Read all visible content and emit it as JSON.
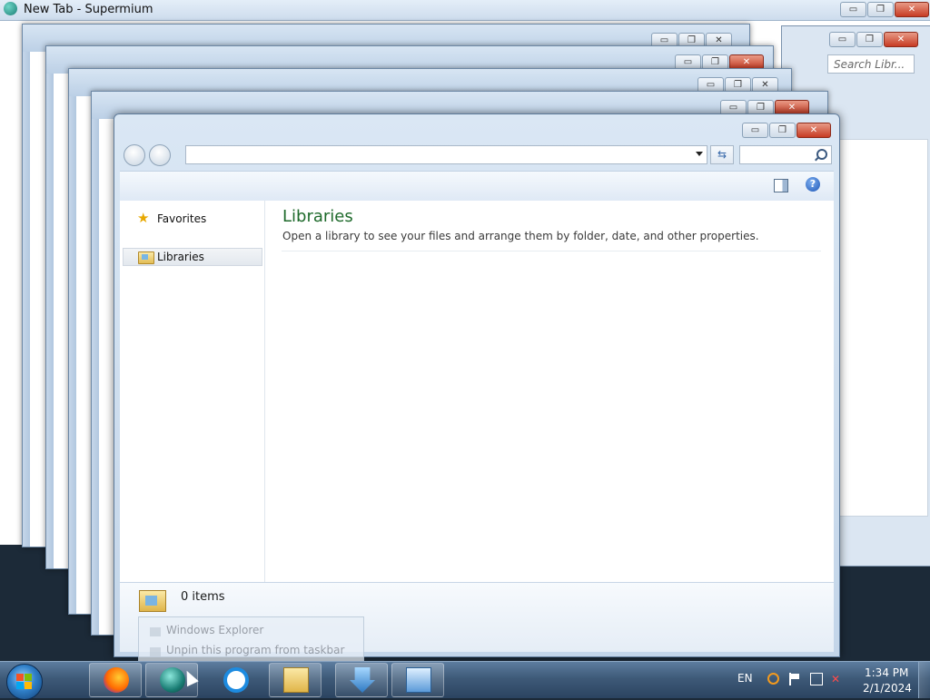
{
  "browser": {
    "title": "New Tab - Supermium",
    "window_buttons": {
      "minimize": "▭",
      "maximize": "❐",
      "close": "✕"
    }
  },
  "background_window": {
    "search_placeholder": "Search Libr..."
  },
  "explorer": {
    "address": "",
    "search": "",
    "nav": {
      "favorites": "Favorites",
      "libraries": "Libraries"
    },
    "content": {
      "title": "Libraries",
      "description": "Open a library to see your files and arrange them by folder, date, and other properties."
    },
    "status": {
      "items": "0 items"
    },
    "window_buttons": {
      "minimize": "▭",
      "maximize": "❐",
      "close": "✕"
    }
  },
  "jumplist": {
    "items": [
      "Windows Explorer",
      "Unpin this program from taskbar"
    ]
  },
  "taskbar": {
    "apps": [
      "firefox-icon",
      "supermium-icon",
      "internet-explorer-icon",
      "media-player-icon",
      "installer-icon",
      "control-panel-icon"
    ],
    "tray": {
      "language": "EN",
      "time": "1:34 PM",
      "date": "2/1/2024"
    }
  },
  "colors": {
    "library_title": "#1e6a2b",
    "taskbar": "#3e5a78",
    "close_button": "#c73b23"
  }
}
